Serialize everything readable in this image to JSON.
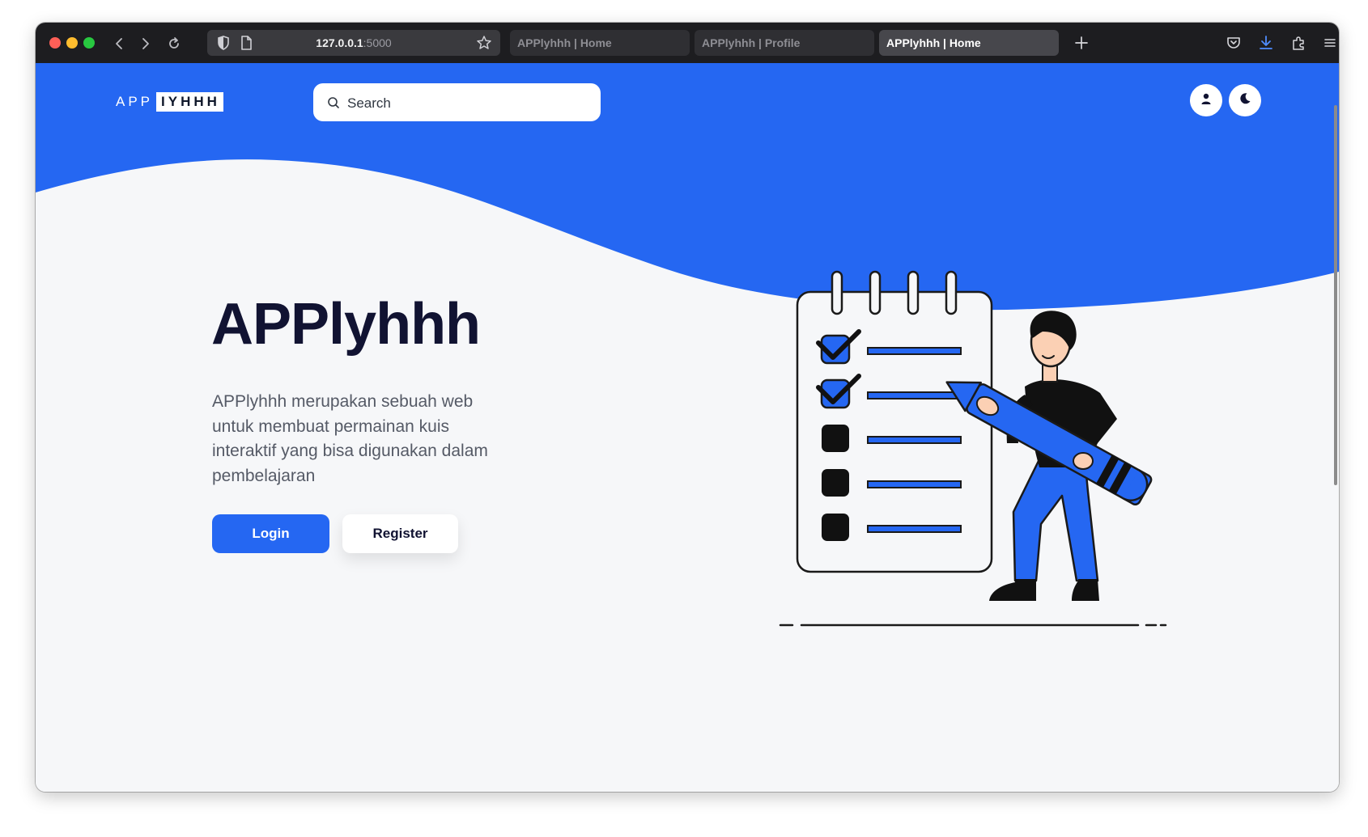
{
  "browser": {
    "url_host": "127.0.0.1",
    "url_port": ":5000",
    "tabs": [
      {
        "label": "APPlyhhh | Home",
        "active": false
      },
      {
        "label": "APPlyhhh | Profile",
        "active": false
      },
      {
        "label": "APPlyhhh | Home",
        "active": true
      }
    ],
    "traffic_light_colors": [
      "#ff5f57",
      "#febc2e",
      "#28c840"
    ],
    "icons": [
      "back-icon",
      "forward-icon",
      "reload-icon",
      "shield-icon",
      "page-icon",
      "star-icon",
      "new-tab-icon",
      "pocket-icon",
      "download-icon",
      "extensions-icon",
      "menu-icon"
    ]
  },
  "header": {
    "logo_left": "APP",
    "logo_right": "IYHHH",
    "search_placeholder": "Search",
    "icons": [
      "user-icon",
      "moon-icon"
    ]
  },
  "hero": {
    "title": "APPlyhhh",
    "description": "APPlyhhh merupakan sebuah web untuk membuat permainan kuis interaktif yang bisa digunakan dalam pembelajaran",
    "login_label": "Login",
    "register_label": "Register"
  },
  "colors": {
    "brand_blue": "#2567f2",
    "page_bg": "#f6f7f9",
    "title_navy": "#111332",
    "text_gray": "#555a66"
  }
}
